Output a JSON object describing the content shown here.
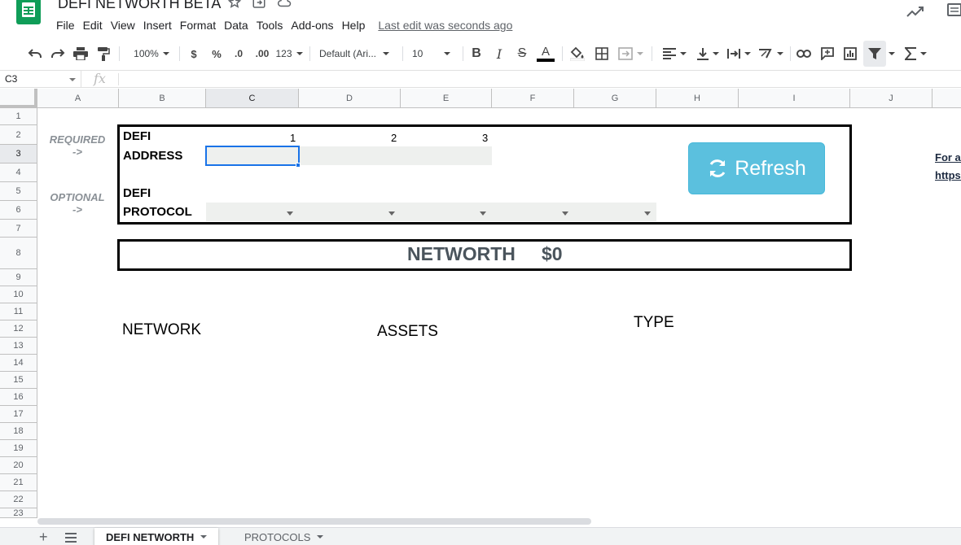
{
  "app": {
    "title": "DEFI NETWORTH BETA",
    "menu": [
      "File",
      "Edit",
      "View",
      "Insert",
      "Format",
      "Data",
      "Tools",
      "Add-ons",
      "Help"
    ],
    "last_edit": "Last edit was seconds ago"
  },
  "toolbar": {
    "zoom": "100%",
    "currency": "$",
    "percent": "%",
    "decrease_decimal": ".0",
    "increase_decimal": ".00",
    "more_formats": "123",
    "font": "Default (Ari...",
    "font_size": "10",
    "bold": "B",
    "italic": "I",
    "strike": "S",
    "text_color": "A"
  },
  "formula_bar": {
    "cell_ref": "C3",
    "fx": "fx",
    "value": ""
  },
  "columns": [
    "A",
    "B",
    "C",
    "D",
    "E",
    "F",
    "G",
    "H",
    "I",
    "J"
  ],
  "selected_column": "C",
  "rows": [
    "1",
    "2",
    "3",
    "4",
    "5",
    "6",
    "7",
    "8",
    "9",
    "10",
    "11",
    "12",
    "13",
    "14",
    "15",
    "16",
    "17",
    "18",
    "19",
    "20",
    "21",
    "22",
    "23"
  ],
  "selected_row": "3",
  "sheet": {
    "required_label": "REQUIRED",
    "arrow_label": "->",
    "optional_label": "OPTIONAL",
    "defi_address_line1": "DEFI",
    "defi_address_line2": "ADDRESS",
    "address_slots": [
      "1",
      "2",
      "3"
    ],
    "defi_protocol_line1": "DEFI",
    "defi_protocol_line2": "PROTOCOL",
    "refresh_label": "Refresh",
    "networth_label": "NETWORTH",
    "networth_value": "$0",
    "col_network": "NETWORK",
    "col_assets": "ASSETS",
    "col_type": "TYPE",
    "side_text_1": "For ac",
    "side_text_2": "https:"
  },
  "sheet_tabs": [
    "DEFI NETWORTH",
    "PROTOCOLS"
  ],
  "colors": {
    "refresh": "#5bc0de",
    "selection": "#1a73e8",
    "sheets_green": "#0f9d58"
  }
}
